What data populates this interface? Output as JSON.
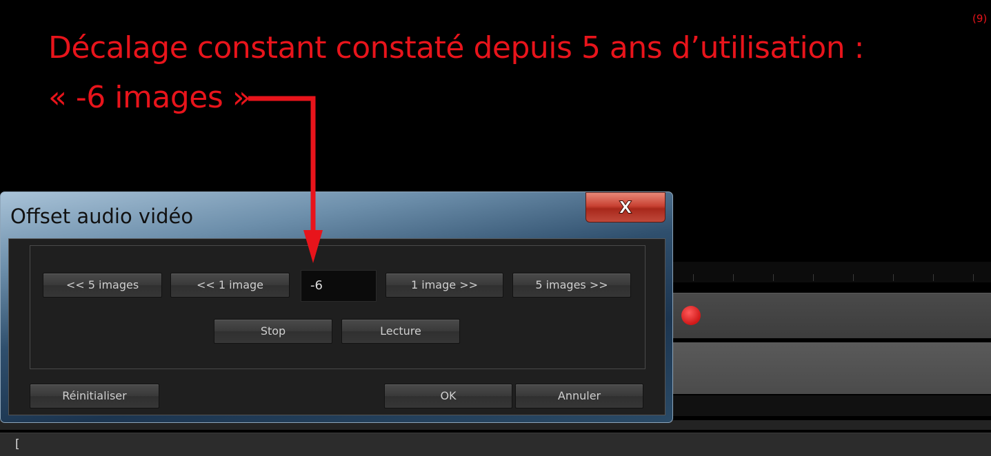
{
  "annotation": {
    "line1": "Décalage constant  constaté depuis 5 ans  d’utilisation :",
    "line2": "« -6 images »",
    "figure_ref": "(9)",
    "color": "#e8141b"
  },
  "dialog": {
    "title": "Offset audio vidéo",
    "close_label": "X",
    "offset_row": {
      "back5_label": "<< 5 images",
      "back1_label": "<< 1 image",
      "offset_value": "-6",
      "fwd1_label": "1 image >>",
      "fwd5_label": "5 images >>"
    },
    "playback": {
      "stop_label": "Stop",
      "play_label": "Lecture"
    },
    "footer": {
      "reset_label": "Réinitialiser",
      "ok_label": "OK",
      "cancel_label": "Annuler"
    }
  },
  "status_bar": {
    "text": "["
  }
}
